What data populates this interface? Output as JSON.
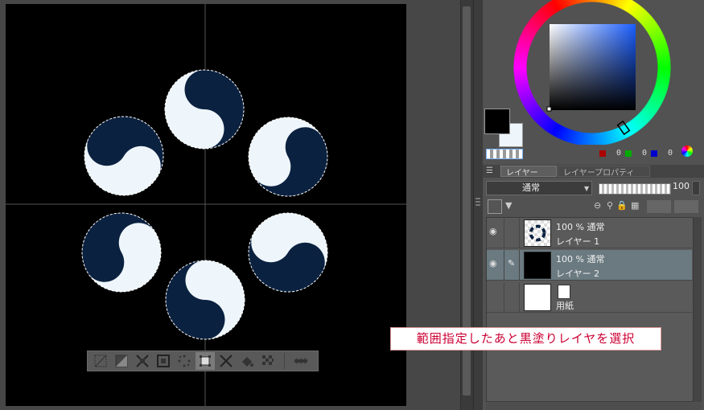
{
  "colors": {
    "navy": "#0b2140",
    "light": "#eef6fb",
    "canvas_bg": "#000000",
    "panel_bg": "#525252",
    "annotation_text": "#cc0033",
    "selected_row": "#6a7a80"
  },
  "control_bar": {
    "icons": [
      "deselect-icon",
      "invert-selection-icon",
      "shrink-selection-icon",
      "expand-selection-icon",
      "selection-points-icon",
      "transform-selection-icon",
      "scale-icon",
      "fill-icon",
      "new-layer-from-selection-icon",
      "tone-icon"
    ]
  },
  "color_panel": {
    "main_color": "#000000",
    "sub_color": "#eef6fb",
    "rgb": [
      {
        "channel": "R",
        "value": "0",
        "color": "#aa0000"
      },
      {
        "channel": "G",
        "value": "0",
        "color": "#00aa00"
      },
      {
        "channel": "B",
        "value": "0",
        "color": "#0000cc"
      }
    ]
  },
  "layer_panel": {
    "tabs": {
      "layer": "レイヤー",
      "property": "レイヤープロパティ"
    },
    "blend_mode": "通常",
    "opacity": "100",
    "layers": [
      {
        "opacity_mode": "100 % 通常",
        "name": "レイヤー 1",
        "visible": true
      },
      {
        "opacity_mode": "100 % 通常",
        "name": "レイヤー 2",
        "visible": true,
        "selected": true
      },
      {
        "opacity_mode": "",
        "name": "用紙",
        "visible": false
      }
    ]
  },
  "annotation": {
    "text": "範囲指定したあと黒塗りレイヤを選択"
  }
}
